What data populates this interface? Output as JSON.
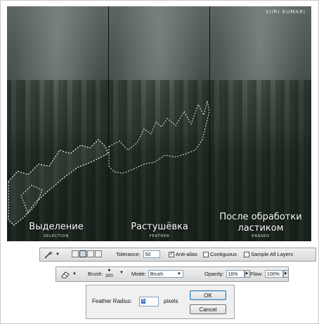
{
  "photo": {
    "credit": "SIIRI KUMARI",
    "panels": [
      {
        "caption": "Выделение",
        "sub": "SELECTION"
      },
      {
        "caption": "Растушёвка",
        "sub": "FEATHER"
      },
      {
        "caption_line1": "После обработки",
        "caption_line2": "ластиком",
        "sub": "ERASED"
      }
    ]
  },
  "magic_wand_bar": {
    "tool_icon": "magic-wand-icon",
    "tolerance_label": "Tolerance:",
    "tolerance_value": "50",
    "antialias_label": "Anti-alias",
    "antialias_checked": true,
    "contiguous_label": "Contiguous",
    "contiguous_checked": false,
    "sample_all_label": "Sample All Layers",
    "sample_all_checked": false
  },
  "eraser_bar": {
    "tool_icon": "eraser-icon",
    "brush_label": "Brush:",
    "brush_size": "300",
    "mode_label": "Mode:",
    "mode_value": "Brush",
    "opacity_label": "Opacity:",
    "opacity_value": "16%",
    "flow_label": "Flow:",
    "flow_value": "100%"
  },
  "feather_dialog": {
    "radius_label": "Feather Radius:",
    "radius_value": "5",
    "unit": "pixels",
    "ok_label": "OK",
    "cancel_label": "Cancel"
  }
}
